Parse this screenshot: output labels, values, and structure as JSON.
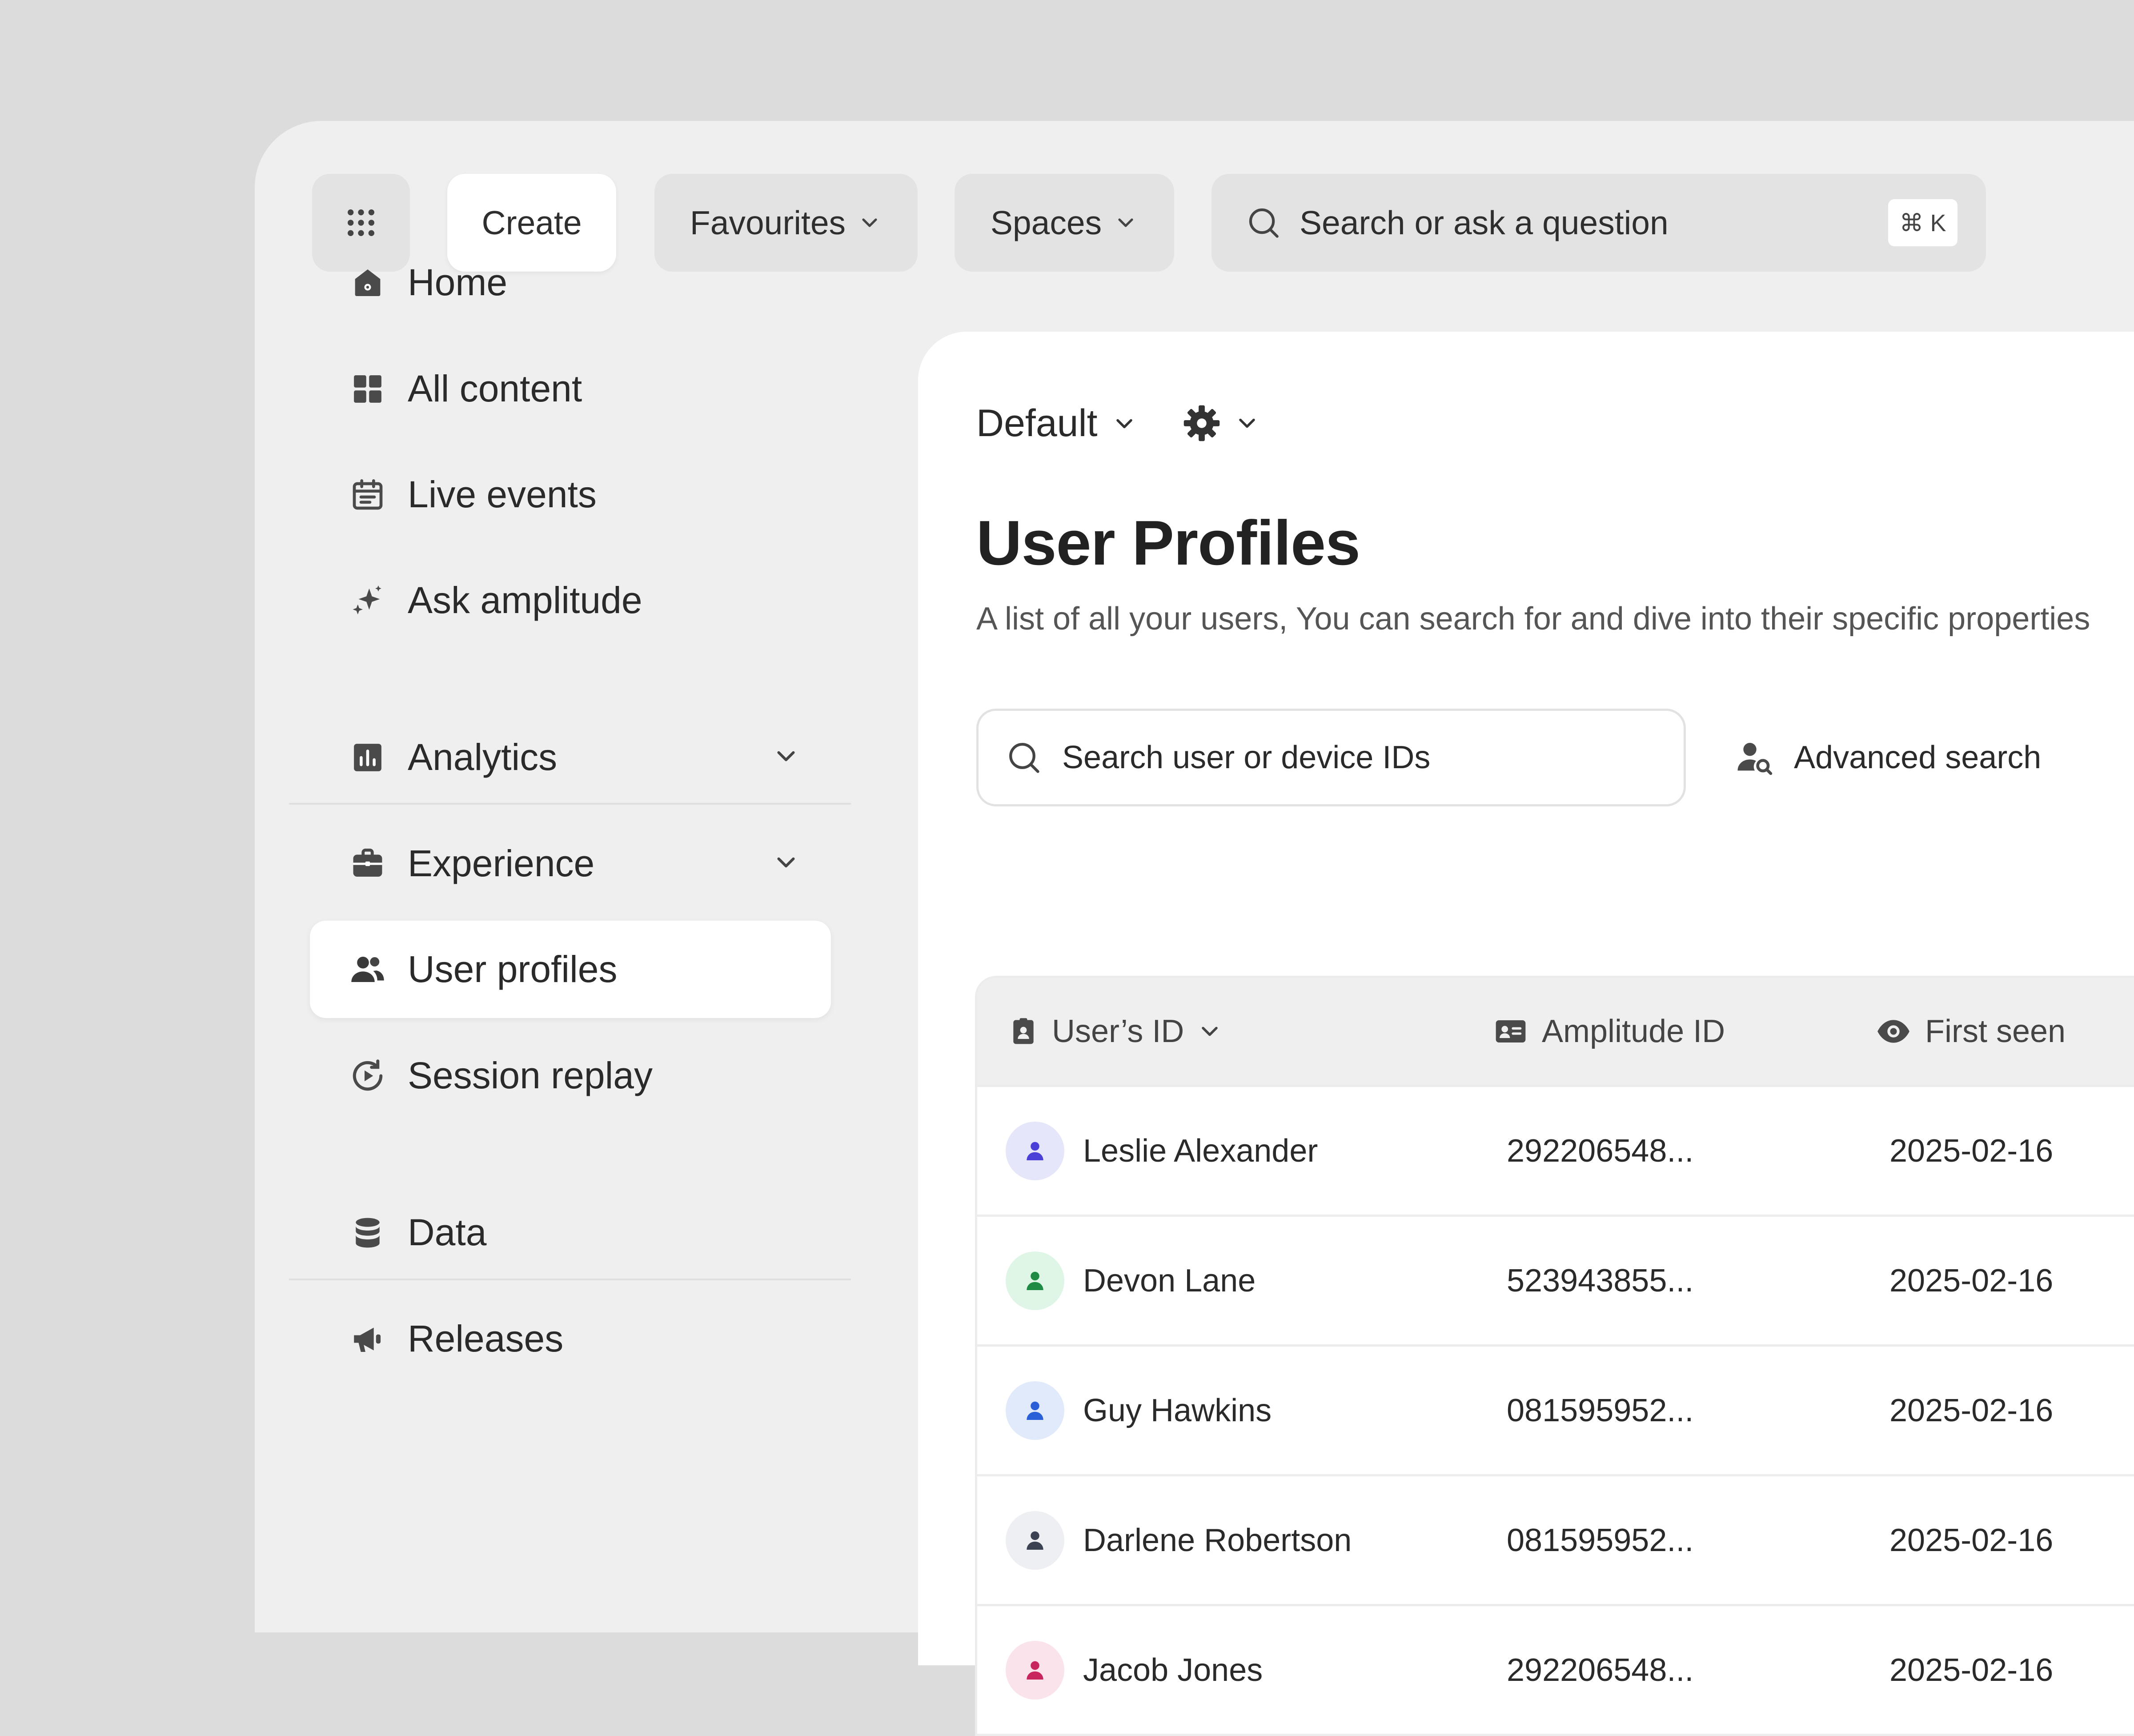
{
  "topbar": {
    "create_label": "Create",
    "favourites_label": "Favourites",
    "spaces_label": "Spaces",
    "search_placeholder": "Search or ask a question",
    "shortcut": "⌘ K"
  },
  "sidebar": {
    "items": [
      {
        "label": "Home",
        "icon": "home-icon"
      },
      {
        "label": "All content",
        "icon": "grid-icon"
      },
      {
        "label": "Live events",
        "icon": "calendar-icon"
      },
      {
        "label": "Ask amplitude",
        "icon": "sparkle-icon"
      },
      {
        "label": "Analytics",
        "icon": "bar-chart-icon"
      },
      {
        "label": "Experience",
        "icon": "briefcase-icon"
      },
      {
        "label": "User profiles",
        "icon": "users-icon",
        "active": true
      },
      {
        "label": "Session replay",
        "icon": "replay-icon"
      },
      {
        "label": "Data",
        "icon": "database-icon"
      },
      {
        "label": "Releases",
        "icon": "megaphone-icon"
      }
    ]
  },
  "main": {
    "dashboard_selector": "Default",
    "title": "User Profiles",
    "subtitle": "A list of all your users, You can search for and dive into their specific properties",
    "search_placeholder": "Search user or device IDs",
    "advanced_search_label": "Advanced search"
  },
  "table": {
    "columns": [
      "User’s ID",
      "Amplitude ID",
      "First seen"
    ],
    "rows": [
      {
        "name": "Leslie Alexander",
        "amplitude_id": "292206548...",
        "first_seen": "2025-02-16",
        "avatar_bg": "#e6e6fb",
        "avatar_fg": "#4a3fd6"
      },
      {
        "name": "Devon Lane",
        "amplitude_id": "523943855...",
        "first_seen": "2025-02-16",
        "avatar_bg": "#dff6e6",
        "avatar_fg": "#1e8a44"
      },
      {
        "name": "Guy Hawkins",
        "amplitude_id": "081595952...",
        "first_seen": "2025-02-16",
        "avatar_bg": "#e1eafb",
        "avatar_fg": "#2a5fd8"
      },
      {
        "name": "Darlene Robertson",
        "amplitude_id": "081595952...",
        "first_seen": "2025-02-16",
        "avatar_bg": "#eeeff2",
        "avatar_fg": "#3b4252"
      },
      {
        "name": "Jacob Jones",
        "amplitude_id": "292206548...",
        "first_seen": "2025-02-16",
        "avatar_bg": "#fbe3ec",
        "avatar_fg": "#c8245e"
      }
    ]
  }
}
